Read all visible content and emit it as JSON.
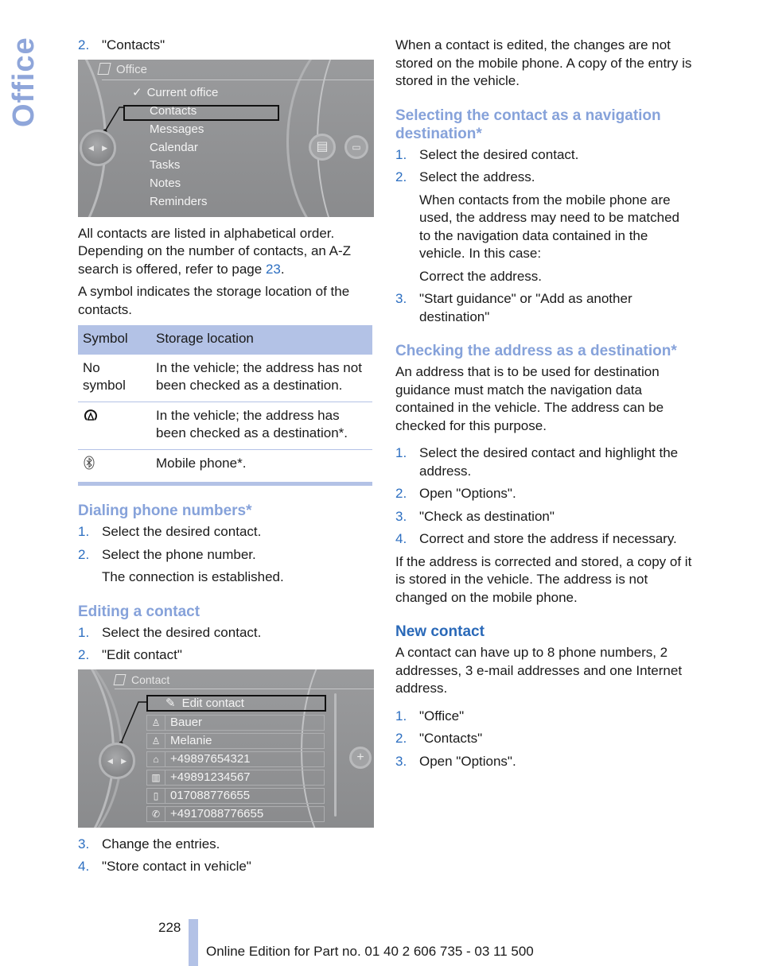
{
  "side_title": "Office",
  "left": {
    "step_contacts": {
      "num": "2.",
      "text": "\"Contacts\""
    },
    "screen1": {
      "title": "Office",
      "items": [
        "Current office",
        "Contacts",
        "Messages",
        "Calendar",
        "Tasks",
        "Notes",
        "Reminders"
      ],
      "checked_item": "Current office",
      "selected_item": "Contacts"
    },
    "para1_pre": "All contacts are listed in alphabetical order. Depending on the number of contacts, an A-Z search is offered, refer to page ",
    "para1_link": "23",
    "para1_post": ".",
    "para2": "A symbol indicates the storage location of the contacts.",
    "table": {
      "headers": [
        "Symbol",
        "Storage location"
      ],
      "rows": [
        {
          "symbol": "No symbol",
          "symbol_icon": "",
          "location": "In the vehicle; the address has not been checked as a destination."
        },
        {
          "symbol": "",
          "symbol_icon": "checked-destination-icon",
          "location": "In the vehicle; the address has been checked as a destination*."
        },
        {
          "symbol": "",
          "symbol_icon": "bluetooth-icon",
          "location": "Mobile phone*."
        }
      ]
    },
    "dialing": {
      "heading": "Dialing phone numbers*",
      "steps": [
        {
          "num": "1.",
          "text": "Select the desired contact."
        },
        {
          "num": "2.",
          "text": "Select the phone number."
        }
      ],
      "note": "The connection is established."
    },
    "editing": {
      "heading": "Editing a contact",
      "steps": [
        {
          "num": "1.",
          "text": "Select the desired contact."
        },
        {
          "num": "2.",
          "text": "\"Edit contact\""
        }
      ]
    },
    "screen2": {
      "title": "Contact",
      "selected_item": "Edit contact",
      "fields": [
        {
          "icon": "person-icon",
          "value": "Bauer"
        },
        {
          "icon": "person-icon",
          "value": "Melanie"
        },
        {
          "icon": "home-phone-icon",
          "value": "+49897654321"
        },
        {
          "icon": "business-phone-icon",
          "value": "+49891234567"
        },
        {
          "icon": "mobile-phone-icon",
          "value": "017088776655"
        },
        {
          "icon": "other-phone-icon",
          "value": "+4917088776655"
        }
      ]
    },
    "steps_after": [
      {
        "num": "3.",
        "text": "Change the entries."
      },
      {
        "num": "4.",
        "text": "\"Store contact in vehicle\""
      }
    ]
  },
  "right": {
    "intro": "When a contact is edited, the changes are not stored on the mobile phone. A copy of the entry is stored in the vehicle.",
    "nav": {
      "heading": "Selecting the contact as a navigation destination*",
      "steps": [
        {
          "num": "1.",
          "text": "Select the desired contact."
        },
        {
          "num": "2.",
          "text": "Select the address."
        }
      ],
      "note1": "When contacts from the mobile phone are used, the address may need to be matched to the navigation data contained in the vehicle. In this case:",
      "note2": "Correct the address.",
      "step3": {
        "num": "3.",
        "text": "\"Start guidance\" or \"Add as another destination\""
      }
    },
    "check": {
      "heading": "Checking the address as a destination*",
      "para": "An address that is to be used for destination guidance must match the navigation data contained in the vehicle. The address can be checked for this purpose.",
      "steps": [
        {
          "num": "1.",
          "text": "Select the desired contact and highlight the address."
        },
        {
          "num": "2.",
          "text": "Open \"Options\"."
        },
        {
          "num": "3.",
          "text": "\"Check as destination\""
        },
        {
          "num": "4.",
          "text": "Correct and store the address if necessary."
        }
      ],
      "after": "If the address is corrected and stored, a copy of it is stored in the vehicle. The address is not changed on the mobile phone."
    },
    "new_contact": {
      "heading": "New contact",
      "para": "A contact can have up to 8 phone numbers, 2 addresses, 3 e-mail addresses and one Internet address.",
      "steps": [
        {
          "num": "1.",
          "text": "\"Office\""
        },
        {
          "num": "2.",
          "text": "\"Contacts\""
        },
        {
          "num": "3.",
          "text": "Open \"Options\"."
        }
      ]
    }
  },
  "footer": {
    "page_number": "228",
    "edition": "Online Edition for Part no. 01 40 2 606 735 - 03 11 500"
  }
}
